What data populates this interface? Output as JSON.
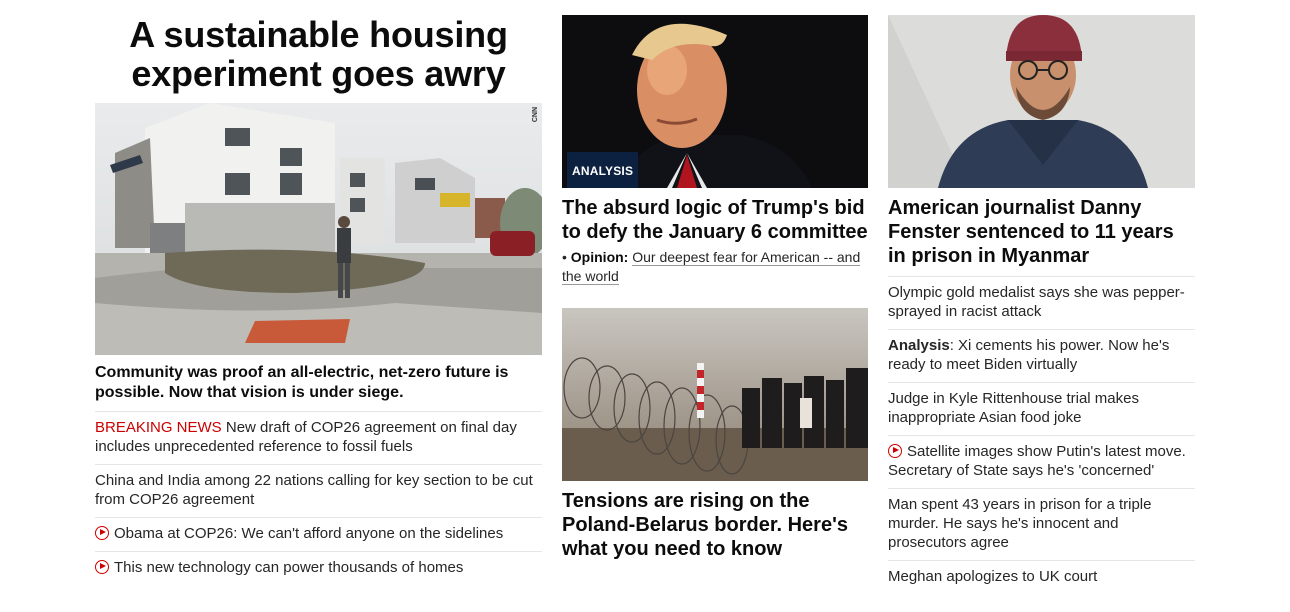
{
  "hero": {
    "title": "A sustainable housing experiment goes awry",
    "watermark": "CNN",
    "caption": "Community was proof an all-electric, net-zero future is possible. Now that vision is under siege."
  },
  "left_list": [
    {
      "prefix": "BREAKING NEWS",
      "text": " New draft of COP26 agreement on final day includes unprecedented reference to fossil fuels",
      "video": false
    },
    {
      "prefix": "",
      "text": "China and India among 22 nations calling for key section to be cut from COP26 agreement",
      "video": false
    },
    {
      "prefix": "",
      "text": "Obama at COP26: We can't afford anyone on the sidelines",
      "video": true
    },
    {
      "prefix": "",
      "text": "This new technology can power thousands of homes",
      "video": true
    }
  ],
  "middle": {
    "top_card": {
      "badge": "ANALYSIS",
      "title": "The absurd logic of Trump's bid to defy the January 6 committee",
      "opinion_label": "Opinion:",
      "opinion_text": "Our deepest fear for American -- and the world"
    },
    "bottom_card": {
      "title": "Tensions are rising on the Poland-Belarus border. Here's what you need to know"
    }
  },
  "right": {
    "card_title": "American journalist Danny Fenster sentenced to 11 years in prison in Myanmar",
    "items": [
      {
        "label": "",
        "text": "Olympic gold medalist says she was pepper-sprayed in racist attack",
        "video": false
      },
      {
        "label": "Analysis",
        "text": ": Xi cements his power. Now he's ready to meet Biden virtually",
        "video": false
      },
      {
        "label": "",
        "text": "Judge in Kyle Rittenhouse trial makes inappropriate Asian food joke",
        "video": false
      },
      {
        "label": "",
        "text": "Satellite images show Putin's latest move. Secretary of State says he's 'concerned'",
        "video": true
      },
      {
        "label": "",
        "text": "Man spent 43 years in prison for a triple murder. He says he's innocent and prosecutors agree",
        "video": false
      },
      {
        "label": "",
        "text": "Meghan apologizes to UK court",
        "video": false
      }
    ]
  },
  "colors": {
    "breaking": "#cc0000",
    "badge_bg": "#0c2040",
    "divider": "#e6e6e6"
  },
  "icons": {
    "video": "play-circle-icon"
  }
}
